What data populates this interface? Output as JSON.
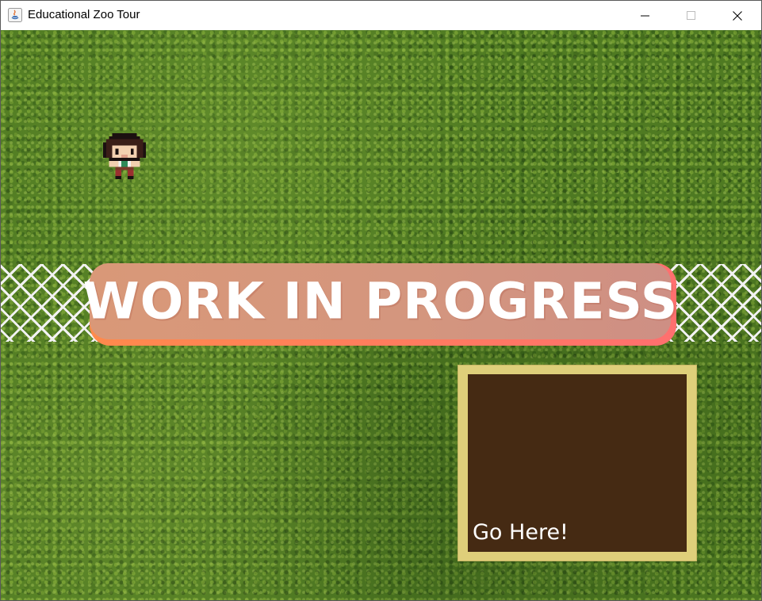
{
  "window": {
    "title": "Educational Zoo Tour",
    "controls": [
      "minimize",
      "maximize",
      "close"
    ]
  },
  "game": {
    "background": "grass",
    "banner": {
      "text": "WORK IN PROGRESS",
      "colors": {
        "start": "#d99878",
        "end": "#ce8f84",
        "shadow_start": "#ff8a4c",
        "shadow_end": "#ff6f6f"
      }
    },
    "goal_box": {
      "label": "Go Here!",
      "colors": {
        "frame": "#dfcf7a",
        "fill": "#452a13"
      }
    },
    "player": {
      "icon": "player-character-sprite"
    },
    "fence": {
      "icon": "chain-link-fence"
    }
  }
}
